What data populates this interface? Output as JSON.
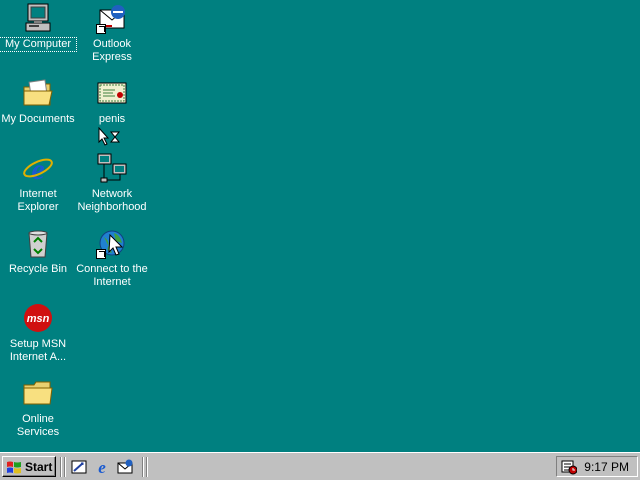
{
  "desktop": {
    "background_color": "#008080",
    "icons": [
      {
        "label": "My Computer",
        "icon": "my-computer-icon"
      },
      {
        "label": "Outlook\nExpress",
        "icon": "outlook-express-icon"
      },
      {
        "label": "My Documents",
        "icon": "my-documents-icon"
      },
      {
        "label": "penis",
        "icon": "certificate-file-icon"
      },
      {
        "label": "Internet\nExplorer",
        "icon": "internet-explorer-icon"
      },
      {
        "label": "Network\nNeighborhood",
        "icon": "network-neighborhood-icon"
      },
      {
        "label": "Recycle Bin",
        "icon": "recycle-bin-icon"
      },
      {
        "label": "Connect to the\nInternet",
        "icon": "connect-internet-icon"
      },
      {
        "label": "Setup MSN\nInternet A...",
        "icon": "msn-icon"
      },
      {
        "label": "Online\nServices",
        "icon": "folder-icon"
      }
    ]
  },
  "taskbar": {
    "start_label": "Start",
    "quick_launch": [
      "show-desktop-icon",
      "internet-explorer-icon",
      "outlook-express-icon"
    ],
    "clock": "9:17 PM",
    "tray_icon": "scheduler-icon"
  }
}
